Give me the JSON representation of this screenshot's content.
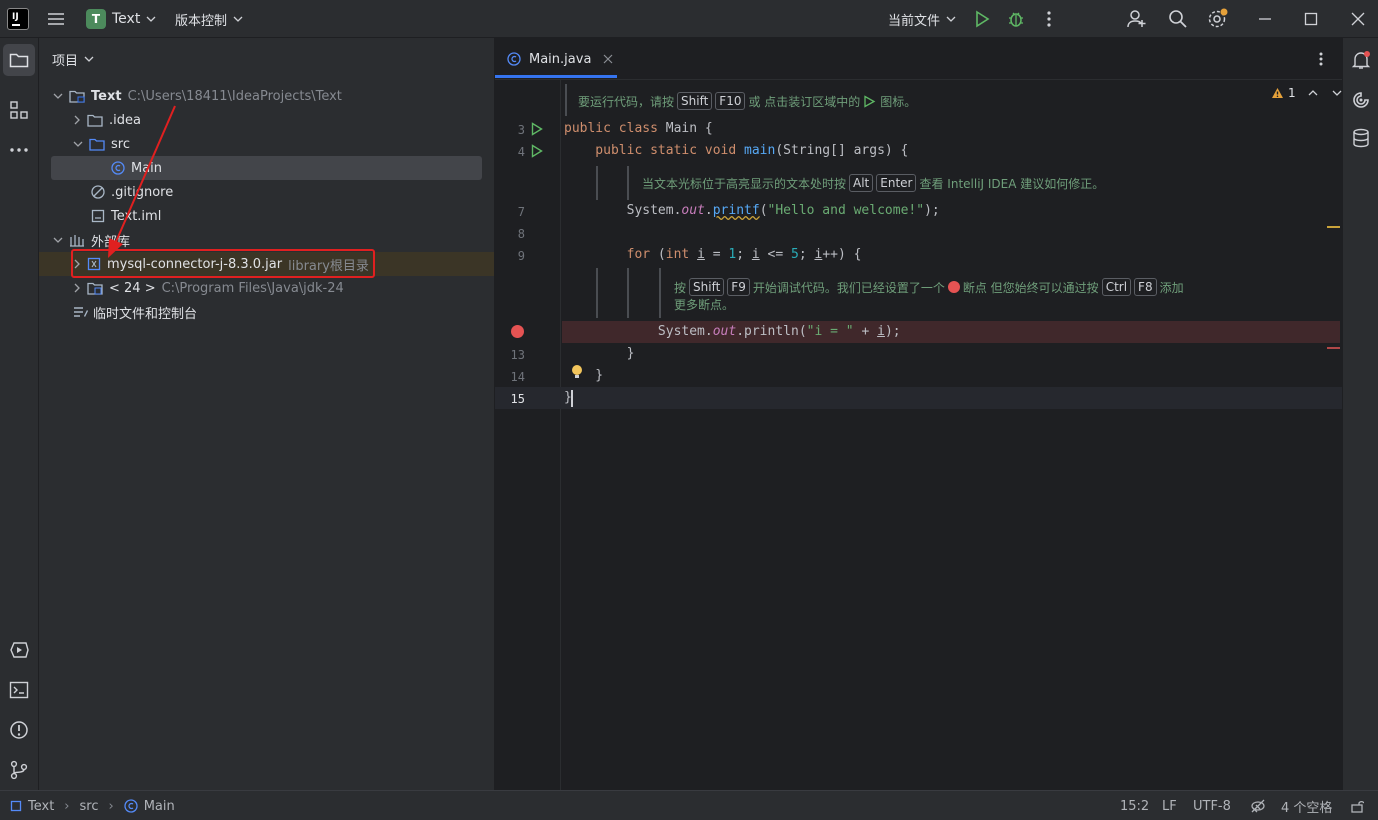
{
  "titlebar": {
    "project_badge": "T",
    "project_name": "Text",
    "vcs": "版本控制",
    "run_config": "当前文件"
  },
  "project_panel": {
    "title": "项目",
    "tree": {
      "root_name": "Text",
      "root_path": "C:\\Users\\18411\\IdeaProjects\\Text",
      "idea": ".idea",
      "src": "src",
      "main": "Main",
      "gitignore": ".gitignore",
      "iml": "Text.iml",
      "external": "外部库",
      "mysql_jar": "mysql-connector-j-8.3.0.jar",
      "mysql_hint": "library根目录",
      "jdk": "< 24 >",
      "jdk_path": "C:\\Program Files\\Java\\jdk-24",
      "scratch": "临时文件和控制台"
    }
  },
  "editor": {
    "tab": "Main.java",
    "warnings": "1",
    "doc1": {
      "a": "要运行代码，请按",
      "k1": "Shift",
      "k2": "F10",
      "b": "或 点击装订区域中的",
      "c": "图标。"
    },
    "doc2": {
      "a": "当文本光标位于高亮显示的文本处时按",
      "k1": "Alt",
      "k2": "Enter",
      "b": "查看 IntelliJ IDEA 建议如何修正。"
    },
    "doc3": {
      "a": "按",
      "k1": "Shift",
      "k2": "F9",
      "b": "开始调试代码。我们已经设置了一个",
      "c": "断点 但您始终可以通过按",
      "k3": "Ctrl",
      "k4": "F8",
      "d": "添加",
      "e": "更多断点。"
    },
    "line_numbers": {
      "l3": "3",
      "l4": "4",
      "l7": "7",
      "l8": "8",
      "l9": "9",
      "l13": "13",
      "l14": "14",
      "l15": "15"
    },
    "code": {
      "c3a": "public class ",
      "c3b": "Main ",
      "c3c": "{",
      "c4a": "    public static void ",
      "c4b": "main",
      "c4c": "(String[] args) {",
      "c7a": "        System.",
      "c7b": "out",
      "c7c": ".",
      "c7d": "printf",
      "c7e": "(",
      "c7f": "\"Hello and welcome!\"",
      "c7g": ");",
      "c9a": "        for ",
      "c9b": "(",
      "c9c": "int ",
      "c9d": "i",
      " c9e": " = ",
      "c9f": "1",
      "c9g": "; ",
      "c9h": "i",
      "c9i": " <= ",
      "c9j": "5",
      "c9k": "; ",
      "c9l": "i",
      "c9m": "++) {",
      "c12a": "            System.",
      "c12b": "out",
      "c12c": ".println(",
      "c12d": "\"i = \"",
      "c12e": " + ",
      "c12f": "i",
      "c12g": ");",
      "c13": "        }",
      "c14": "    }",
      "c15": "}"
    }
  },
  "status": {
    "crumb_project": "Text",
    "crumb_src": "src",
    "crumb_main": "Main",
    "position": "15:2",
    "line_sep": "LF",
    "encoding": "UTF-8",
    "indent": "4 个空格"
  },
  "colors": {
    "accent": "#3574f0",
    "breakpoint": "#e55353",
    "annotation": "#e02020",
    "run": "#5fb865"
  }
}
